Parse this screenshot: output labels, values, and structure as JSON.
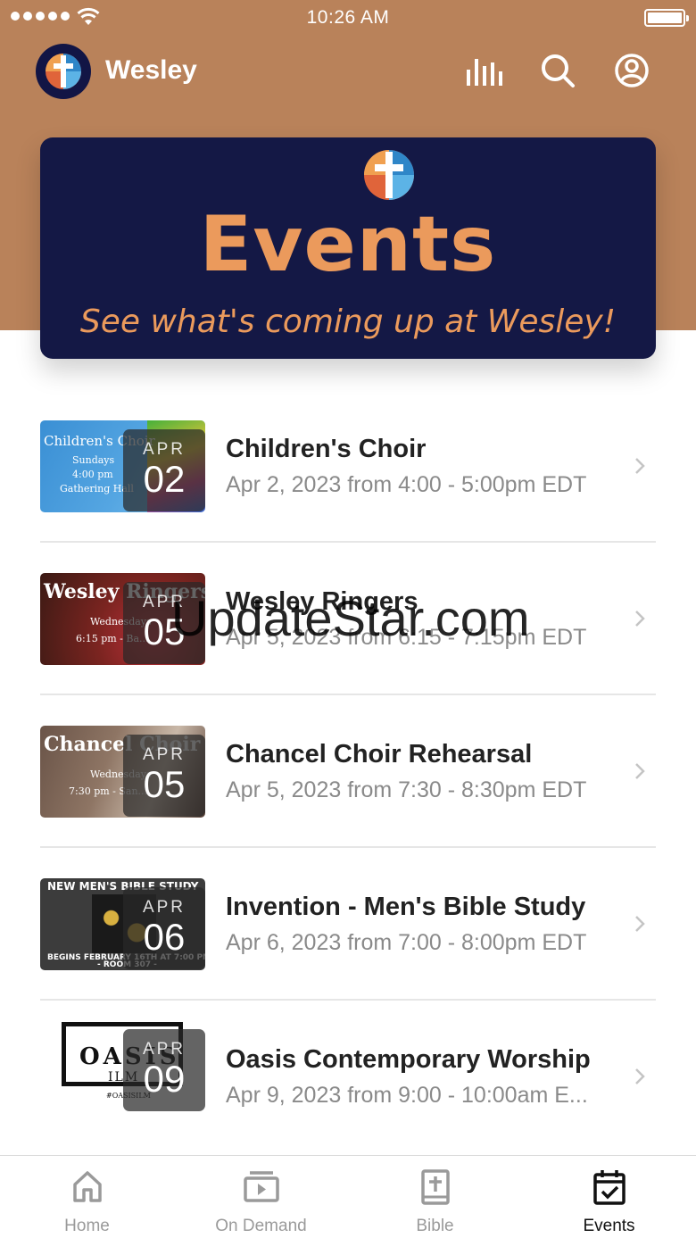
{
  "status_bar": {
    "time": "10:26 AM"
  },
  "header": {
    "title": "Wesley"
  },
  "banner": {
    "title": "Events",
    "subtitle": "See what's coming up at Wesley!"
  },
  "events": [
    {
      "title": "Children's Choir",
      "time": "Apr 2, 2023 from 4:00 - 5:00pm EDT",
      "month": "APR",
      "day": "02",
      "thumb_title": "Children's Choir",
      "thumb_lines": [
        "Sundays",
        "4:00 pm",
        "Gathering Hall"
      ]
    },
    {
      "title": "Wesley Ringers",
      "time": "Apr 5, 2023 from 6:15 - 7:15pm EDT",
      "month": "APR",
      "day": "05",
      "thumb_title": "Wesley Ringers",
      "thumb_lines": [
        "Wednesdays",
        "6:15 pm - Ba..."
      ]
    },
    {
      "title": "Chancel Choir Rehearsal",
      "time": "Apr 5, 2023 from 7:30 - 8:30pm EDT",
      "month": "APR",
      "day": "05",
      "thumb_title": "Chancel Choir",
      "thumb_lines": [
        "Wednesdays",
        "7:30 pm - San..."
      ]
    },
    {
      "title": "Invention - Men's Bible Study",
      "time": "Apr 6, 2023 from 7:00 - 8:00pm EDT",
      "month": "APR",
      "day": "06",
      "thumb_title": "NEW MEN'S BIBLE STUDY",
      "thumb_lines": [
        "BEGINS FEBRUARY 16TH AT 7:00 PM",
        "- ROOM 307 -"
      ]
    },
    {
      "title": "Oasis Contemporary Worship",
      "time": "Apr 9, 2023 from 9:00 - 10:00am E...",
      "month": "APR",
      "day": "09",
      "thumb_title": "OASIS",
      "thumb_lines": [
        "ILM",
        "#OASISILM"
      ]
    }
  ],
  "tabs": [
    {
      "label": "Home",
      "icon": "home-icon"
    },
    {
      "label": "On Demand",
      "icon": "on-demand-icon"
    },
    {
      "label": "Bible",
      "icon": "bible-icon"
    },
    {
      "label": "Events",
      "icon": "calendar-icon"
    }
  ],
  "watermark": "UpdateStar.com",
  "colors": {
    "header": "#b9825a",
    "banner": "#141845",
    "accent": "#eb9a5c"
  }
}
